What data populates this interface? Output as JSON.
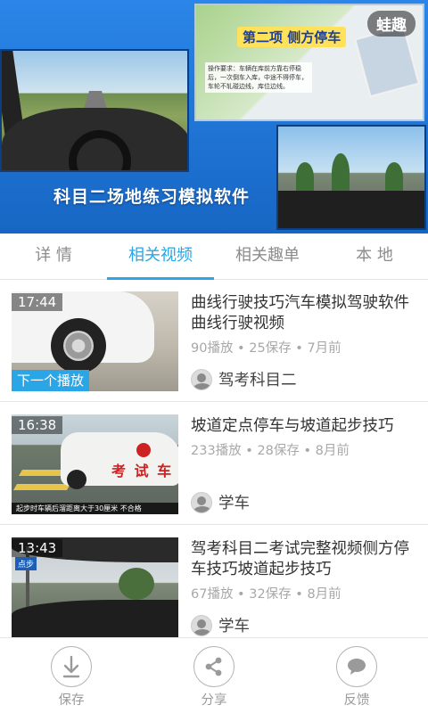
{
  "player": {
    "watermark": "蛙趣",
    "caption": "科目二场地练习模拟软件",
    "diagram_title": "第二项  侧方停车",
    "diagram_note": "操作要求：车辆在库前方靠右停稳后，一次倒车入库，中途不得停车，车轮不轧碰边线，库位边线。"
  },
  "tabs": [
    {
      "label": "详 情",
      "active": false
    },
    {
      "label": "相关视频",
      "active": true
    },
    {
      "label": "相关趣单",
      "active": false
    },
    {
      "label": "本 地",
      "active": false
    }
  ],
  "videos": [
    {
      "duration": "17:44",
      "badge": "下一个播放",
      "title": "曲线行驶技巧汽车模拟驾驶软件曲线行驶视频",
      "meta": "90播放 • 25保存 • 7月前",
      "author": "驾考科目二"
    },
    {
      "duration": "16:38",
      "title": "坡道定点停车与坡道起步技巧",
      "meta": "233播放 • 28保存 • 8月前",
      "author": "学车",
      "thumb_sign": "考 试 车",
      "thumb_sub": "起步时车辆后溜距离大于30厘米  不合格"
    },
    {
      "duration": "13:43",
      "title": "驾考科目二考试完整视频侧方停车技巧坡道起步技巧",
      "meta": "67播放 • 32保存 • 8月前",
      "author": "学车",
      "thumb_sign": "点步"
    }
  ],
  "bottom_bar": [
    {
      "label": "保存",
      "icon": "download-icon"
    },
    {
      "label": "分享",
      "icon": "share-icon"
    },
    {
      "label": "反馈",
      "icon": "chat-bubble-icon"
    }
  ],
  "colors": {
    "accent": "#2aa6e6",
    "player_bg": "#1a6fcf"
  }
}
